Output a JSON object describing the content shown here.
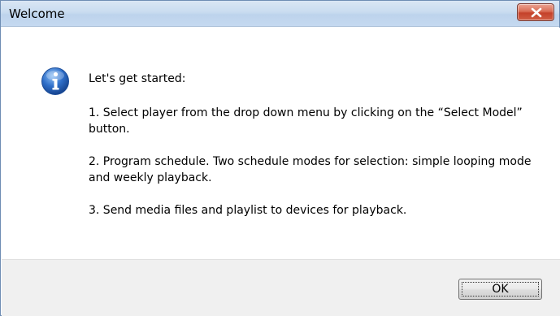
{
  "window": {
    "title": "Welcome",
    "close_icon": "close-x-icon",
    "close_color": "#c4412a"
  },
  "message": {
    "icon": "info-icon",
    "icon_color": "#2f6fc9",
    "intro": "Let's get started:",
    "steps": [
      "1. Select player from the drop down menu by clicking on the “Select Model” button.",
      "2. Program schedule. Two schedule modes for selection: simple looping mode and weekly playback.",
      "3. Send media files and playlist to devices for playback."
    ]
  },
  "buttons": {
    "ok_label": "OK"
  }
}
